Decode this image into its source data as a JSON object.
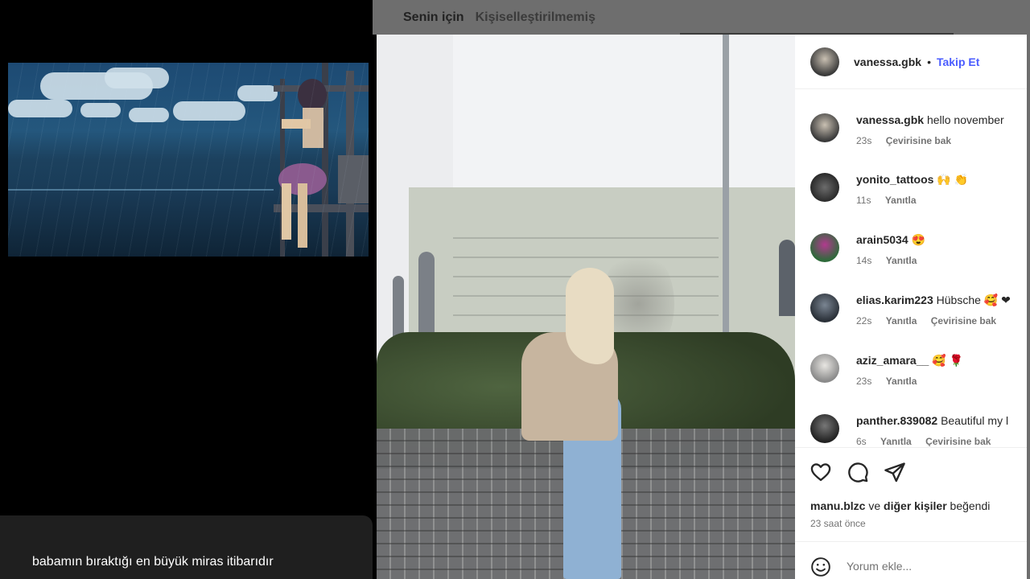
{
  "video": {
    "subtitle": "babamın bıraktığı en büyük miras itibarıdır"
  },
  "tabs": [
    {
      "label": "Senin için"
    },
    {
      "label": "Kişiselleştirilmemiş"
    }
  ],
  "post": {
    "author": "vanessa.gbk",
    "separator": "•",
    "follow_label": "Takip Et"
  },
  "comments": [
    {
      "user": "vanessa.gbk",
      "text": "hello november",
      "time": "23s",
      "actions": [
        "Çevirisine bak"
      ]
    },
    {
      "user": "yonito_tattoos",
      "text": "🙌 👏",
      "time": "11s",
      "actions": [
        "Yanıtla"
      ]
    },
    {
      "user": "arain5034",
      "text": "😍",
      "time": "14s",
      "actions": [
        "Yanıtla"
      ]
    },
    {
      "user": "elias.karim223",
      "text": "Hübsche 🥰 ❤",
      "time": "22s",
      "actions": [
        "Yanıtla",
        "Çevirisine bak"
      ]
    },
    {
      "user": "aziz_amara__",
      "text": "🥰 🌹",
      "time": "23s",
      "actions": [
        "Yanıtla"
      ]
    },
    {
      "user": "panther.839082",
      "text": "Beautiful my l",
      "time": "6s",
      "actions": [
        "Yanıtla",
        "Çevirisine bak"
      ]
    }
  ],
  "likes": {
    "user": "manu.blzc",
    "connector": "ve",
    "others": "diğer kişiler",
    "suffix": "beğendi"
  },
  "posted_ago": "23 saat önce",
  "comment_box": {
    "placeholder": "Yorum ekle..."
  },
  "colors": {
    "follow": "#4a5cff",
    "overlay": "#6e6e6e"
  },
  "icons": [
    "heart-icon",
    "comment-icon",
    "share-icon",
    "emoji-icon"
  ]
}
